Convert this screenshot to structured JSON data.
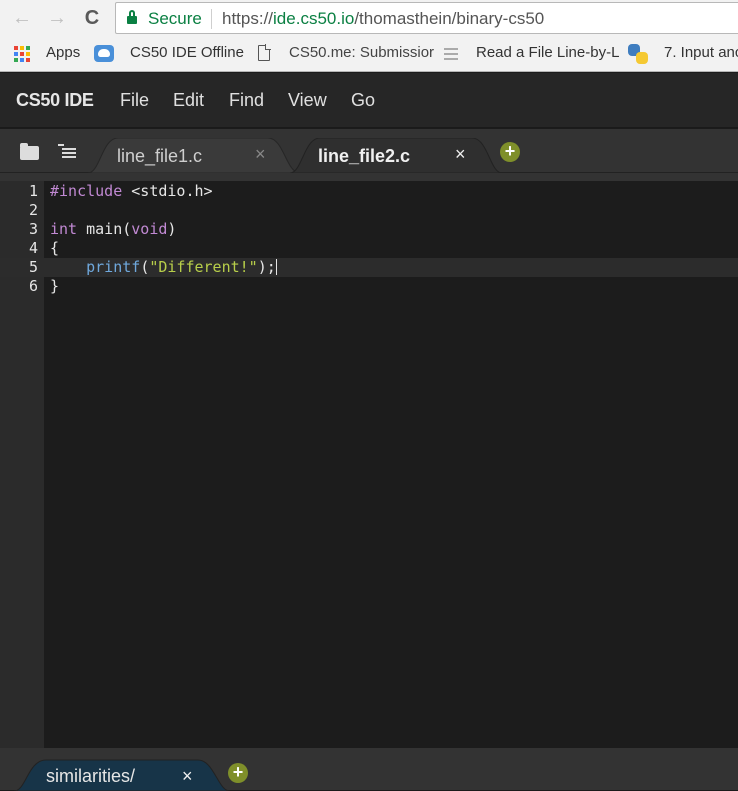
{
  "browser": {
    "nav": {
      "back": "←",
      "forward": "→",
      "reload": "C"
    },
    "security_label": "Secure",
    "url_scheme": "https://",
    "url_host": "ide.cs50.io",
    "url_path": "/thomasthein/binary-cs50",
    "bookmarks": [
      {
        "label": "Apps",
        "icon": "apps-grid-icon"
      },
      {
        "label": "CS50 IDE Offline",
        "icon": "cloud-icon"
      },
      {
        "label": "CS50.me: Submissior",
        "icon": "document-icon"
      },
      {
        "label": "Read a File Line-by-L",
        "icon": "list-icon"
      },
      {
        "label": "7. Input anc",
        "icon": "python-icon"
      }
    ],
    "apps_colors": [
      "#ea4335",
      "#fbbc05",
      "#34a853",
      "#4285f4",
      "#ea4335",
      "#fbbc05",
      "#34a853",
      "#4285f4",
      "#ea4335"
    ]
  },
  "ide": {
    "brand": "CS50 IDE",
    "menu": [
      "File",
      "Edit",
      "Find",
      "View",
      "Go"
    ],
    "tabs": [
      {
        "label": "line_file1.c",
        "close": "×",
        "active": false
      },
      {
        "label": "line_file2.c",
        "close": "×",
        "active": true
      }
    ],
    "add_tab": "+",
    "editor": {
      "active_line": 5,
      "lines": [
        {
          "num": "1",
          "tokens": [
            {
              "t": "#include",
              "c": "pre"
            },
            {
              "t": " <stdio.h>",
              "c": "plain"
            }
          ]
        },
        {
          "num": "2",
          "tokens": []
        },
        {
          "num": "3",
          "tokens": [
            {
              "t": "int",
              "c": "kw"
            },
            {
              "t": " main(",
              "c": "plain"
            },
            {
              "t": "void",
              "c": "kw"
            },
            {
              "t": ")",
              "c": "plain"
            }
          ]
        },
        {
          "num": "4",
          "tokens": [
            {
              "t": "{",
              "c": "plain"
            }
          ]
        },
        {
          "num": "5",
          "tokens": [
            {
              "t": "    ",
              "c": "plain"
            },
            {
              "t": "printf",
              "c": "fn"
            },
            {
              "t": "(",
              "c": "plain"
            },
            {
              "t": "\"Different!\"",
              "c": "str"
            },
            {
              "t": ");",
              "c": "plain"
            }
          ]
        },
        {
          "num": "6",
          "tokens": [
            {
              "t": "}",
              "c": "plain"
            }
          ]
        }
      ]
    },
    "bottom_tab": {
      "label": "similarities/",
      "close": "×"
    },
    "bottom_add": "+",
    "accent_colors": {
      "add_button": "#7f8f2a",
      "bottom_tab_bg": "#173448"
    }
  }
}
